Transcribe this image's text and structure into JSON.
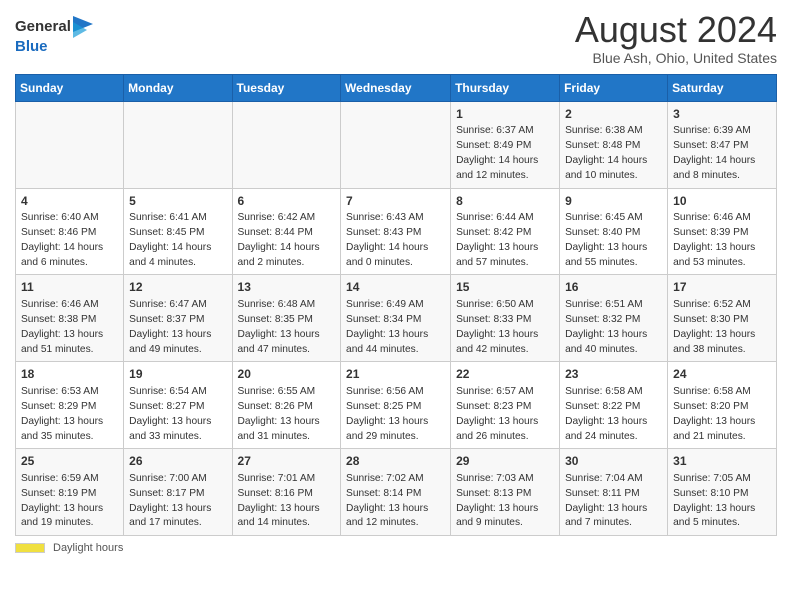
{
  "header": {
    "logo_general": "General",
    "logo_blue": "Blue",
    "title": "August 2024",
    "subtitle": "Blue Ash, Ohio, United States"
  },
  "calendar": {
    "days_of_week": [
      "Sunday",
      "Monday",
      "Tuesday",
      "Wednesday",
      "Thursday",
      "Friday",
      "Saturday"
    ],
    "weeks": [
      [
        {
          "day": "",
          "info": ""
        },
        {
          "day": "",
          "info": ""
        },
        {
          "day": "",
          "info": ""
        },
        {
          "day": "",
          "info": ""
        },
        {
          "day": "1",
          "info": "Sunrise: 6:37 AM\nSunset: 8:49 PM\nDaylight: 14 hours and 12 minutes."
        },
        {
          "day": "2",
          "info": "Sunrise: 6:38 AM\nSunset: 8:48 PM\nDaylight: 14 hours and 10 minutes."
        },
        {
          "day": "3",
          "info": "Sunrise: 6:39 AM\nSunset: 8:47 PM\nDaylight: 14 hours and 8 minutes."
        }
      ],
      [
        {
          "day": "4",
          "info": "Sunrise: 6:40 AM\nSunset: 8:46 PM\nDaylight: 14 hours and 6 minutes."
        },
        {
          "day": "5",
          "info": "Sunrise: 6:41 AM\nSunset: 8:45 PM\nDaylight: 14 hours and 4 minutes."
        },
        {
          "day": "6",
          "info": "Sunrise: 6:42 AM\nSunset: 8:44 PM\nDaylight: 14 hours and 2 minutes."
        },
        {
          "day": "7",
          "info": "Sunrise: 6:43 AM\nSunset: 8:43 PM\nDaylight: 14 hours and 0 minutes."
        },
        {
          "day": "8",
          "info": "Sunrise: 6:44 AM\nSunset: 8:42 PM\nDaylight: 13 hours and 57 minutes."
        },
        {
          "day": "9",
          "info": "Sunrise: 6:45 AM\nSunset: 8:40 PM\nDaylight: 13 hours and 55 minutes."
        },
        {
          "day": "10",
          "info": "Sunrise: 6:46 AM\nSunset: 8:39 PM\nDaylight: 13 hours and 53 minutes."
        }
      ],
      [
        {
          "day": "11",
          "info": "Sunrise: 6:46 AM\nSunset: 8:38 PM\nDaylight: 13 hours and 51 minutes."
        },
        {
          "day": "12",
          "info": "Sunrise: 6:47 AM\nSunset: 8:37 PM\nDaylight: 13 hours and 49 minutes."
        },
        {
          "day": "13",
          "info": "Sunrise: 6:48 AM\nSunset: 8:35 PM\nDaylight: 13 hours and 47 minutes."
        },
        {
          "day": "14",
          "info": "Sunrise: 6:49 AM\nSunset: 8:34 PM\nDaylight: 13 hours and 44 minutes."
        },
        {
          "day": "15",
          "info": "Sunrise: 6:50 AM\nSunset: 8:33 PM\nDaylight: 13 hours and 42 minutes."
        },
        {
          "day": "16",
          "info": "Sunrise: 6:51 AM\nSunset: 8:32 PM\nDaylight: 13 hours and 40 minutes."
        },
        {
          "day": "17",
          "info": "Sunrise: 6:52 AM\nSunset: 8:30 PM\nDaylight: 13 hours and 38 minutes."
        }
      ],
      [
        {
          "day": "18",
          "info": "Sunrise: 6:53 AM\nSunset: 8:29 PM\nDaylight: 13 hours and 35 minutes."
        },
        {
          "day": "19",
          "info": "Sunrise: 6:54 AM\nSunset: 8:27 PM\nDaylight: 13 hours and 33 minutes."
        },
        {
          "day": "20",
          "info": "Sunrise: 6:55 AM\nSunset: 8:26 PM\nDaylight: 13 hours and 31 minutes."
        },
        {
          "day": "21",
          "info": "Sunrise: 6:56 AM\nSunset: 8:25 PM\nDaylight: 13 hours and 29 minutes."
        },
        {
          "day": "22",
          "info": "Sunrise: 6:57 AM\nSunset: 8:23 PM\nDaylight: 13 hours and 26 minutes."
        },
        {
          "day": "23",
          "info": "Sunrise: 6:58 AM\nSunset: 8:22 PM\nDaylight: 13 hours and 24 minutes."
        },
        {
          "day": "24",
          "info": "Sunrise: 6:58 AM\nSunset: 8:20 PM\nDaylight: 13 hours and 21 minutes."
        }
      ],
      [
        {
          "day": "25",
          "info": "Sunrise: 6:59 AM\nSunset: 8:19 PM\nDaylight: 13 hours and 19 minutes."
        },
        {
          "day": "26",
          "info": "Sunrise: 7:00 AM\nSunset: 8:17 PM\nDaylight: 13 hours and 17 minutes."
        },
        {
          "day": "27",
          "info": "Sunrise: 7:01 AM\nSunset: 8:16 PM\nDaylight: 13 hours and 14 minutes."
        },
        {
          "day": "28",
          "info": "Sunrise: 7:02 AM\nSunset: 8:14 PM\nDaylight: 13 hours and 12 minutes."
        },
        {
          "day": "29",
          "info": "Sunrise: 7:03 AM\nSunset: 8:13 PM\nDaylight: 13 hours and 9 minutes."
        },
        {
          "day": "30",
          "info": "Sunrise: 7:04 AM\nSunset: 8:11 PM\nDaylight: 13 hours and 7 minutes."
        },
        {
          "day": "31",
          "info": "Sunrise: 7:05 AM\nSunset: 8:10 PM\nDaylight: 13 hours and 5 minutes."
        }
      ]
    ]
  },
  "footer": {
    "daylight_label": "Daylight hours"
  }
}
